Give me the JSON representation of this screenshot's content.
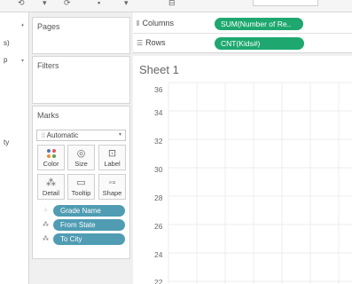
{
  "left_strip": {
    "frag1": "s)",
    "frag2": "p",
    "frag3": "ty"
  },
  "pages": {
    "title": "Pages"
  },
  "filters": {
    "title": "Filters"
  },
  "marks": {
    "title": "Marks",
    "type": "Automatic",
    "buttons": {
      "color": "Color",
      "size": "Size",
      "label": "Label",
      "detail": "Detail",
      "tooltip": "Tooltip",
      "shape": "Shape"
    },
    "fields": [
      "Grade Name",
      "From State",
      "To City"
    ]
  },
  "shelves": {
    "columns_label": "Columns",
    "columns_pill": "SUM(Number of Re..",
    "rows_label": "Rows",
    "rows_pill": "CNT(Kids#)"
  },
  "sheet": {
    "title": "Sheet 1",
    "y_ticks": [
      "36",
      "34",
      "32",
      "30",
      "28",
      "26",
      "24",
      "22"
    ]
  },
  "colors": {
    "field_pill": "#4f9cb3",
    "measure_pill": "#1ea86f"
  }
}
